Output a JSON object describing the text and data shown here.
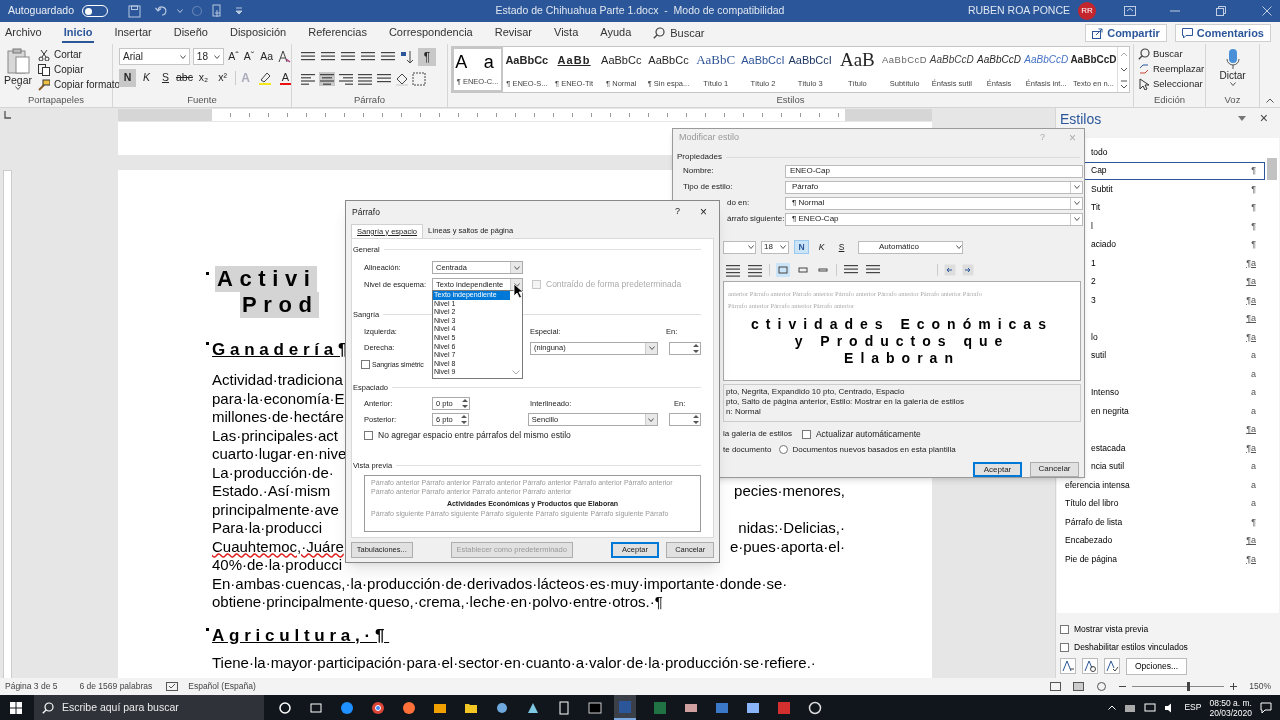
{
  "title_bar": {
    "autosave_label": "Autoguardado",
    "autosave_on": false,
    "title": "Estado de Chihuahua Parte 1.docx  -  Modo de compatibilidad",
    "user": "RUBEN ROA PONCE",
    "avatar": "RR"
  },
  "menu_tabs": [
    {
      "label": "Archivo",
      "selected": false
    },
    {
      "label": "Inicio",
      "selected": true
    },
    {
      "label": "Insertar",
      "selected": false
    },
    {
      "label": "Diseño",
      "selected": false
    },
    {
      "label": "Disposición",
      "selected": false
    },
    {
      "label": "Referencias",
      "selected": false
    },
    {
      "label": "Correspondencia",
      "selected": false
    },
    {
      "label": "Revisar",
      "selected": false
    },
    {
      "label": "Vista",
      "selected": false
    },
    {
      "label": "Ayuda",
      "selected": false
    }
  ],
  "search": {
    "label": "Buscar"
  },
  "share_button": "Compartir",
  "comments_button": "Comentarios",
  "clipboard": {
    "paste": "Pegar",
    "items": [
      "Cortar",
      "Copiar",
      "Copiar formato"
    ],
    "label": "Portapapeles"
  },
  "font": {
    "name": "Arial",
    "size": "18",
    "grow": "Aˆ",
    "shrink": "Aˇ",
    "case": "Aa",
    "effects": "A",
    "font_color": "A",
    "label": "Fuente",
    "format_buttons": [
      {
        "label": "N",
        "kind": "bold",
        "selected": true
      },
      {
        "label": "K",
        "kind": "italic",
        "selected": false
      },
      {
        "label": "S",
        "kind": "underline",
        "selected": false
      },
      {
        "label": "abc",
        "kind": "strike",
        "selected": false
      },
      {
        "label": "x₂",
        "kind": "sub",
        "selected": false
      },
      {
        "label": "x²",
        "kind": "sup",
        "selected": false
      }
    ]
  },
  "paragraph": {
    "show_marks": "¶",
    "show_marks_on": true,
    "label": "Párrafo",
    "alignments": [
      {
        "selected": false
      },
      {
        "selected": true
      },
      {
        "selected": false
      },
      {
        "selected": false
      }
    ]
  },
  "styles_gallery": {
    "label": "Estilos",
    "items": [
      {
        "sample": "A a",
        "name": "¶ ENEO-C...",
        "kind": "spaced",
        "selected": true
      },
      {
        "sample": "AaBbCc",
        "name": "¶ ENEO-S...",
        "kind": "bold",
        "selected": false
      },
      {
        "sample": "AaBb",
        "name": "¶ ENEO-Tit",
        "kind": "underline",
        "selected": false
      },
      {
        "sample": "AaBbCc",
        "name": "¶ Normal",
        "kind": "normal",
        "selected": false
      },
      {
        "sample": "AaBbCc",
        "name": "¶ Sin espa...",
        "kind": "normal",
        "selected": false
      },
      {
        "sample": "AaBbC",
        "name": "Título 1",
        "kind": "heading1",
        "selected": false
      },
      {
        "sample": "AaBbCcI",
        "name": "Título 2",
        "kind": "heading2",
        "selected": false
      },
      {
        "sample": "AaBbCcI",
        "name": "Título 3",
        "kind": "heading3",
        "selected": false
      },
      {
        "sample": "AaB",
        "name": "Título",
        "kind": "title",
        "selected": false
      },
      {
        "sample": "AaBbCcD",
        "name": "Subtítulo",
        "kind": "subtitle",
        "selected": false
      },
      {
        "sample": "AaBbCcD",
        "name": "Énfasis sutil",
        "kind": "emphasis_subtle",
        "selected": false
      },
      {
        "sample": "AaBbCcD",
        "name": "Énfasis",
        "kind": "emphasis",
        "selected": false
      },
      {
        "sample": "AaBbCcD",
        "name": "Énfasis int...",
        "kind": "emphasis_intense",
        "selected": false
      },
      {
        "sample": "AaBbCcD",
        "name": "Texto en n...",
        "kind": "strong",
        "selected": false
      }
    ]
  },
  "editing": {
    "items": [
      "Buscar",
      "Reemplazar",
      "Seleccionar"
    ],
    "label": "Edición"
  },
  "voice": {
    "button": "Dictar",
    "label": "Voz"
  },
  "document": {
    "heading_lines": [
      "Activi",
      "Prod"
    ],
    "section_1": "Ganadería¶",
    "lines_1": [
      {
        "left": "Actividad·tradiciona"
      },
      {
        "left": "para·la·economía·E"
      },
      {
        "left": "millones·de·hectáre"
      },
      {
        "left": "Las·principales·act"
      },
      {
        "left": "cuarto·lugar·en·nive"
      },
      {
        "left": "La·producción·de·"
      },
      {
        "left": "Estado.·Así·mism",
        "right": "pecies·menores,"
      },
      {
        "left": "principalmente·ave"
      },
      {
        "left": "Para·la·producci",
        "right": "nidas:·Delicias,·"
      },
      {
        "left": "Cuauhtemoc,·Juáre",
        "right": "e·pues·aporta·el·",
        "spell_error": true
      },
      {
        "left": "40%·de·la·producci"
      },
      {
        "left": "En·ambas·cuencas,·la·producción·de·derivados·lácteos·es·muy·importante·donde·se·"
      },
      {
        "left": "obtiene·principalmente·queso,·crema,·leche·en·polvo·entre·otros.·¶"
      }
    ],
    "section_2": "Agricultura,·¶",
    "lines_2": [
      {
        "left": "Tiene·la·mayor·participación·para·el·sector·en·cuanto·a·valor·de·la·producción·se·refiere.·"
      }
    ]
  },
  "paragraph_dialog": {
    "title": "Párrafo",
    "help": "?",
    "close": "×",
    "tabs": [
      {
        "label": "Sangría y espacio",
        "selected": true
      },
      {
        "label": "Líneas y saltos de página",
        "selected": false
      }
    ],
    "general": "General",
    "alignment_label": "Alineación:",
    "alignment": "Centrada",
    "outline_label": "Nivel de esquema:",
    "outline": "Texto independiente",
    "collapsed": {
      "label": "Contraído de forma predeterminada",
      "checked": false,
      "disabled": true
    },
    "outline_options": [
      {
        "label": "Texto independiente",
        "selected": true
      },
      {
        "label": "Nivel 1",
        "selected": false
      },
      {
        "label": "Nivel 2",
        "selected": false
      },
      {
        "label": "Nivel 3",
        "selected": false
      },
      {
        "label": "Nivel 4",
        "selected": false
      },
      {
        "label": "Nivel 5",
        "selected": false
      },
      {
        "label": "Nivel 6",
        "selected": false
      },
      {
        "label": "Nivel 7",
        "selected": false
      },
      {
        "label": "Nivel 8",
        "selected": false
      },
      {
        "label": "Nivel 9",
        "selected": false
      }
    ],
    "indent": "Sangría",
    "left_label": "Izquierda:",
    "right_label": "Derecha:",
    "special_label": "Especial:",
    "special": "(ninguna)",
    "by_label": "En:",
    "mirror": {
      "label": "Sangrías simétric",
      "checked": false
    },
    "spacing": "Espaciado",
    "before_label": "Anterior:",
    "before": "0 pto",
    "after_label": "Posterior:",
    "after": "6 pto",
    "line_spacing_label": "Interlineado:",
    "line_spacing": "Sencillo",
    "at_label": "En:",
    "no_space": {
      "label": "No agregar espacio entre párrafos del mismo estilo",
      "checked": false
    },
    "preview_label": "Vista previa",
    "preview_before": "Párrafo anterior Párrafo anterior Párrafo anterior Párrafo anterior Párrafo anterior Párrafo anterior Párrafo anterior Párrafo anterior Párrafo anterior Párrafo anterior",
    "preview_sample": "Actividades Económicas y Productos que Elaboran",
    "preview_after": "Párrafo siguiente Párrafo siguiente Párrafo siguiente Párrafo siguiente Párrafo siguiente Párrafo",
    "buttons": [
      {
        "label": "Tabulaciones...",
        "disabled": false,
        "default": false
      },
      {
        "label": "Establecer como predeterminado",
        "disabled": true,
        "default": false
      },
      {
        "label": "Aceptar",
        "disabled": false,
        "default": true
      },
      {
        "label": "Cancelar",
        "disabled": false,
        "default": false
      }
    ]
  },
  "modify_style_dialog": {
    "title": "Modificar estilo",
    "help": "?",
    "close": "×",
    "properties": "Propiedades",
    "fields": [
      {
        "label": "Nombre:",
        "value": "ENEO-Cap",
        "kind": "text"
      },
      {
        "label": "Tipo de estilo:",
        "value": "Párrafo",
        "kind": "select"
      },
      {
        "label": "do en:",
        "value": "¶ Normal",
        "kind": "select"
      },
      {
        "label": "árrafo siguiente:",
        "value": "¶ ENEO-Cap",
        "kind": "select"
      }
    ],
    "size": "18",
    "format_buttons": [
      {
        "label": "N",
        "kind": "bold",
        "selected": true
      },
      {
        "label": "K",
        "kind": "italic",
        "selected": false
      },
      {
        "label": "S",
        "kind": "underline",
        "selected": false
      }
    ],
    "font_color_value": "Automático",
    "spacing_buttons": [
      {
        "selected": true
      },
      {
        "selected": false
      },
      {
        "selected": false
      }
    ],
    "preview_before": [
      "anterior Párrafo anterior Párrafo anterior Párrafo anterior Párrafo anterior Párrafo anterior Párrafo",
      "Párrafo anterior Párrafo anterior Párrafo anterior"
    ],
    "preview_sample": [
      "ctividades Económicas",
      "y Productos que",
      "Elaboran"
    ],
    "description": [
      "pto, Negrita, Expandido  10 pto, Centrado, Espacio",
      "pto, Salto de página anterior, Estilo: Mostrar en la galería de estilos",
      "n: Normal"
    ],
    "gallery_text": "la galería de estilos",
    "auto_update": {
      "label": "Actualizar automáticamente",
      "checked": false
    },
    "document_text": "te documento",
    "template_option": {
      "label": "Documentos nuevos basados en esta plantilla",
      "selected": false
    },
    "buttons": [
      {
        "label": "Aceptar",
        "default": true
      },
      {
        "label": "Cancelar",
        "default": false
      }
    ]
  },
  "styles_pane": {
    "title": "Estilos",
    "close": "×",
    "items": [
      {
        "label": "todo",
        "selected": false
      },
      {
        "label": "Cap",
        "mark": "¶",
        "selected": true
      },
      {
        "label": "Subtit",
        "mark": "¶",
        "selected": false
      },
      {
        "label": "Tit",
        "mark": "¶",
        "selected": false
      },
      {
        "label": "l",
        "mark": "¶",
        "selected": false
      },
      {
        "label": "aciado",
        "mark": "¶",
        "selected": false
      },
      {
        "label": "1",
        "mark": "¶a",
        "selected": false
      },
      {
        "label": "2",
        "mark": "¶a",
        "selected": false
      },
      {
        "label": "3",
        "mark": "¶a",
        "selected": false
      },
      {
        "mark": "¶a",
        "selected": false
      },
      {
        "label": "lo",
        "mark": "¶a",
        "selected": false
      },
      {
        "label": "sutil",
        "mark": "a",
        "selected": false
      },
      {
        "mark": "a",
        "selected": false
      },
      {
        "label": "Intenso",
        "mark": "a",
        "selected": false
      },
      {
        "label": "en negrita",
        "mark": "a",
        "selected": false
      },
      {
        "mark": "¶a",
        "selected": false
      },
      {
        "label": "estacada",
        "mark": "¶a",
        "selected": false
      },
      {
        "label": "ncia sutil",
        "mark": "a",
        "selected": false
      },
      {
        "label": "eferencia intensa",
        "mark": "a",
        "selected": false
      },
      {
        "label": "Título del libro",
        "mark": "a",
        "selected": false
      },
      {
        "label": "Párrafo de lista",
        "mark": "¶",
        "selected": false
      },
      {
        "label": "Encabezado",
        "mark": "¶a",
        "selected": false
      },
      {
        "label": "Pie de página",
        "mark": "¶a",
        "selected": false
      }
    ],
    "show_preview": {
      "label": "Mostrar vista previa",
      "checked": false
    },
    "disable_linked": {
      "label": "Deshabilitar estilos vinculados",
      "checked": false
    },
    "options_button": "Opciones..."
  },
  "status_bar": {
    "page": "Página 3 de 5",
    "words": "6 de 1569 palabras",
    "language": "Español (España)",
    "zoom": "150%",
    "zoom_slider": {
      "level": 0.6
    }
  },
  "taskbar": {
    "search_placeholder": "Escribe aquí para buscar",
    "language": "ESP",
    "time": "08:50 a. m.",
    "date": "20/03/2020"
  }
}
